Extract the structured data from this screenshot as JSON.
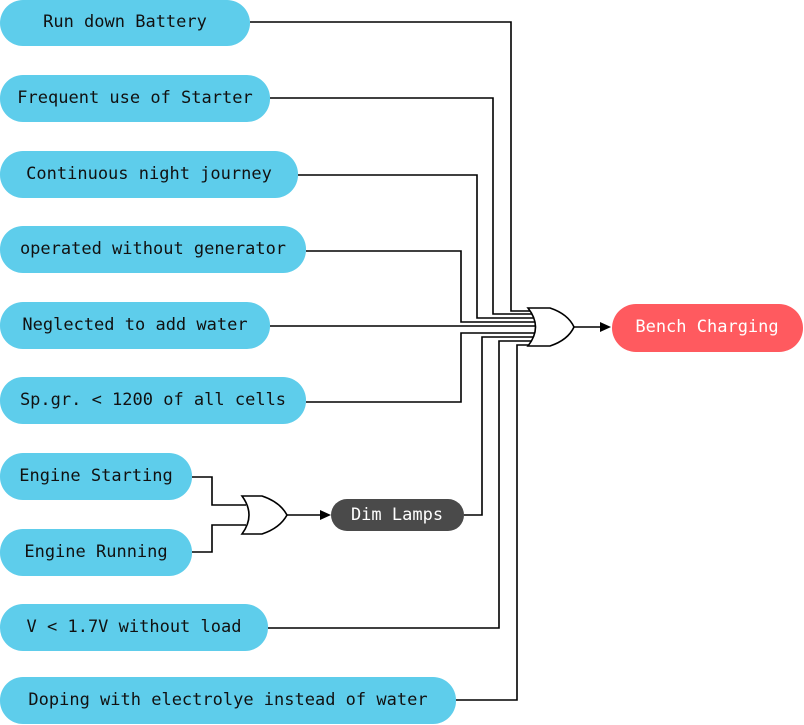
{
  "colors": {
    "input_node": "#5ecdeb",
    "result_node": "#ff5a5f",
    "intermediate_node": "#4a4a4a",
    "input_text": "#111111",
    "light_text": "#ffffff",
    "wire": "#000000"
  },
  "inputs": [
    "Run down Battery",
    "Frequent use of Starter",
    "Continuous night journey",
    "operated without generator",
    "Neglected to add water",
    "Sp.gr. < 1200 of all cells",
    "Engine Starting",
    "Engine Running",
    "V < 1.7V without load",
    "Doping with electrolye instead of water"
  ],
  "intermediate": "Dim Lamps",
  "result": "Bench Charging",
  "gates": [
    {
      "type": "OR",
      "inputs": [
        "Engine Starting",
        "Engine Running"
      ],
      "output": "Dim Lamps"
    },
    {
      "type": "OR",
      "inputs": [
        "Run down Battery",
        "Frequent use of Starter",
        "Continuous night journey",
        "operated without generator",
        "Neglected to add water",
        "Sp.gr. < 1200 of all cells",
        "Dim Lamps",
        "V < 1.7V without load",
        "Doping with electrolye instead of water"
      ],
      "output": "Bench Charging"
    }
  ]
}
